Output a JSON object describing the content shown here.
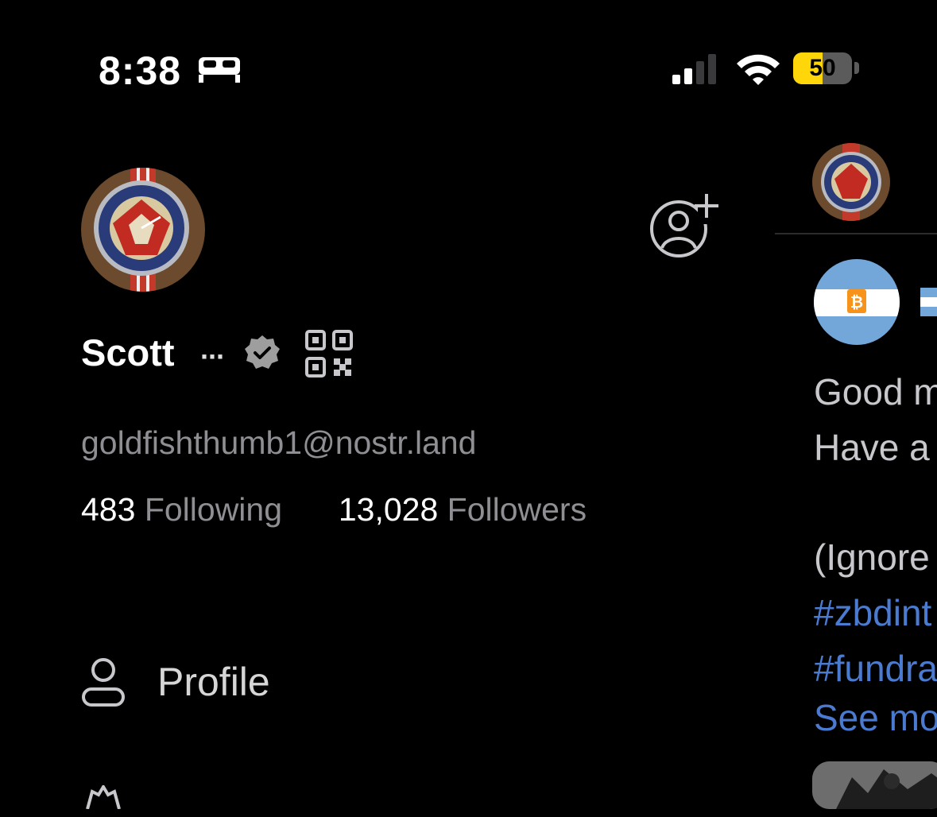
{
  "status_bar": {
    "time": "8:38",
    "focus_icon": "bed-icon",
    "battery_level": "50",
    "battery_fraction": 0.5,
    "battery_color": "#ffd60a"
  },
  "drawer": {
    "display_name": "Scott",
    "more_label": "···",
    "nip05": "goldfishthumb1@nostr.land",
    "following_count": "483",
    "following_label": "Following",
    "followers_count": "13,028",
    "followers_label": "Followers",
    "menu": [
      {
        "label": "Profile",
        "icon": "person-icon"
      }
    ]
  },
  "feed_peek": {
    "post_lines": [
      "Good m",
      "Have a",
      "(Ignore"
    ],
    "hashtags": [
      "#zbdint",
      "#fundra"
    ],
    "see_more": "See mo"
  },
  "colors": {
    "background": "#000000",
    "secondary_text": "#8e8e93",
    "link": "#4a7bd0"
  }
}
